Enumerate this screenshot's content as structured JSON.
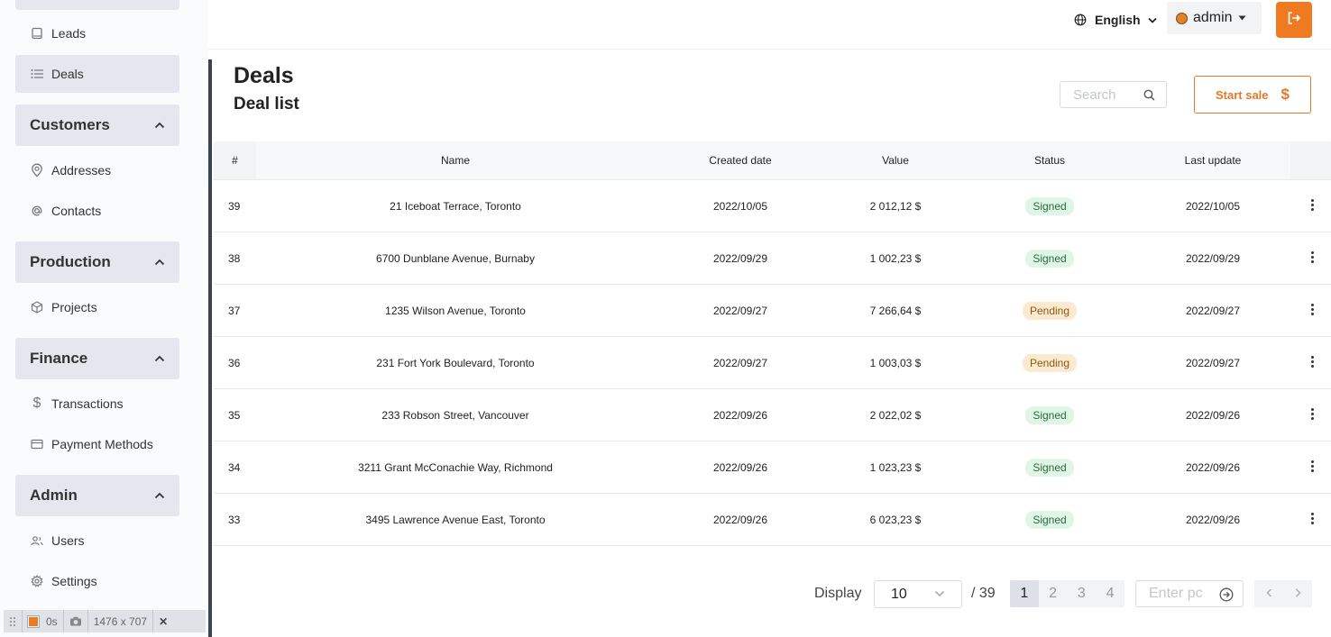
{
  "sidebar": {
    "leads": "Leads",
    "deals": "Deals",
    "sections": {
      "customers": "Customers",
      "production": "Production",
      "finance": "Finance",
      "admin": "Admin"
    },
    "addresses": "Addresses",
    "contacts": "Contacts",
    "projects": "Projects",
    "transactions": "Transactions",
    "payment_methods": "Payment Methods",
    "users": "Users",
    "settings": "Settings"
  },
  "devbar": {
    "time": "0s",
    "size": "1476 x 707"
  },
  "topbar": {
    "language": "English",
    "user": "admin"
  },
  "header": {
    "title": "Deals",
    "subtitle": "Deal list",
    "search_placeholder": "Search",
    "start_sale": "Start sale",
    "start_sale_symbol": "$"
  },
  "table": {
    "columns": {
      "id": "#",
      "name": "Name",
      "created": "Created date",
      "value": "Value",
      "status": "Status",
      "updated": "Last update"
    },
    "rows": [
      {
        "id": "39",
        "name": "21 Iceboat Terrace, Toronto",
        "created": "2022/10/05",
        "value": "2 012,12 $",
        "status": "Signed",
        "updated": "2022/10/05"
      },
      {
        "id": "38",
        "name": "6700 Dunblane Avenue, Burnaby",
        "created": "2022/09/29",
        "value": "1 002,23 $",
        "status": "Signed",
        "updated": "2022/09/29"
      },
      {
        "id": "37",
        "name": "1235 Wilson Avenue, Toronto",
        "created": "2022/09/27",
        "value": "7 266,64 $",
        "status": "Pending",
        "updated": "2022/09/27"
      },
      {
        "id": "36",
        "name": "231 Fort York Boulevard, Toronto",
        "created": "2022/09/27",
        "value": "1 003,03 $",
        "status": "Pending",
        "updated": "2022/09/27"
      },
      {
        "id": "35",
        "name": "233 Robson Street, Vancouver",
        "created": "2022/09/26",
        "value": "2 022,02 $",
        "status": "Signed",
        "updated": "2022/09/26"
      },
      {
        "id": "34",
        "name": "3211 Grant McConachie Way, Richmond",
        "created": "2022/09/26",
        "value": "1 023,23 $",
        "status": "Signed",
        "updated": "2022/09/26"
      },
      {
        "id": "33",
        "name": "3495 Lawrence Avenue East, Toronto",
        "created": "2022/09/26",
        "value": "6 023,23 $",
        "status": "Signed",
        "updated": "2022/09/26"
      }
    ]
  },
  "pagination": {
    "display_label": "Display",
    "page_size": "10",
    "total": "/ 39",
    "pages": [
      "1",
      "2",
      "3",
      "4"
    ],
    "goto_placeholder": "Enter pc"
  },
  "colors": {
    "accent": "#f07a1f",
    "signed_bg": "#dff5e6",
    "pending_bg": "#fbead0"
  }
}
